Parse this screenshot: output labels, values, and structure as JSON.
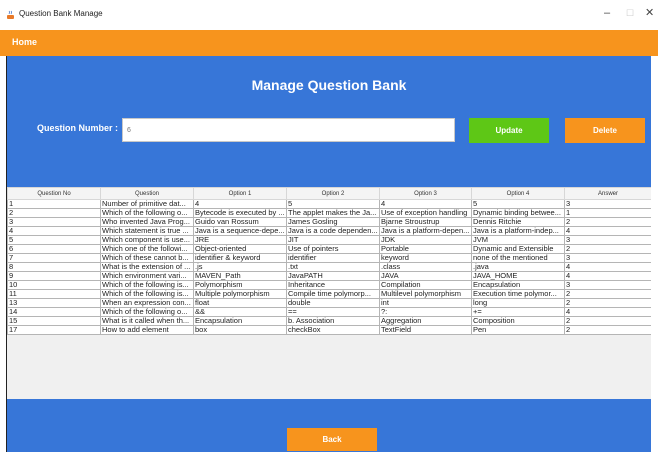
{
  "window": {
    "title": "Question Bank Manage",
    "minimize": "–",
    "maximize": "☐",
    "close": "✕"
  },
  "menu": {
    "home": "Home"
  },
  "header": {
    "title": "Manage Question Bank",
    "question_label": "Question Number :",
    "question_value": "6",
    "update_label": "Update",
    "delete_label": "Delete"
  },
  "colors": {
    "accent_orange": "#f7941d",
    "panel_blue": "#3776d8",
    "update_green": "#5ec716"
  },
  "table": {
    "columns": [
      "Question No",
      "Question",
      "Option 1",
      "Option 2",
      "Option 3",
      "Option 4",
      "Answer"
    ],
    "rows": [
      [
        "1",
        "Number of primitive dat...",
        "4",
        "5",
        "4",
        "5",
        "3"
      ],
      [
        "2",
        "Which of the following o...",
        "Bytecode is executed by ...",
        "The applet makes the Ja...",
        "Use of exception handling",
        "Dynamic binding betwee...",
        "1"
      ],
      [
        "3",
        "Who invented Java Prog...",
        "Guido van Rossum",
        "James Gosling",
        "Bjarne Stroustrup",
        "Dennis Ritchie",
        "2"
      ],
      [
        "4",
        "Which statement is true ...",
        "Java is a sequence-depe...",
        "Java is a code dependen...",
        "Java is a platform-depen...",
        "Java is a platform-indep...",
        "4"
      ],
      [
        "5",
        "Which component is use...",
        "JRE",
        "JIT",
        "JDK",
        "JVM",
        "3"
      ],
      [
        "6",
        "Which one of the followi...",
        "Object-oriented",
        "Use of pointers",
        "Portable",
        "Dynamic and Extensible",
        "2"
      ],
      [
        "7",
        "Which of these cannot b...",
        "identifier & keyword",
        "identifier",
        "keyword",
        "none of the mentioned",
        "3"
      ],
      [
        "8",
        "What is the extension of ...",
        ".js",
        ".txt",
        ".class",
        ".java",
        "4"
      ],
      [
        "9",
        "Which environment vari...",
        "MAVEN_Path",
        "JavaPATH",
        "JAVA",
        "JAVA_HOME",
        "4"
      ],
      [
        "10",
        "Which of the following is...",
        "Polymorphism",
        "Inheritance",
        "Compilation",
        "Encapsulation",
        "3"
      ],
      [
        "11",
        "Which of the following is...",
        "Multiple polymorphism",
        "Compile time polymorp...",
        "Multilevel polymorphism",
        "Execution time polymor...",
        "2"
      ],
      [
        "13",
        "When an expression con...",
        "float",
        "double",
        "int",
        "long",
        "2"
      ],
      [
        "14",
        "Which of the following o...",
        "&&",
        "==",
        "?:",
        "+=",
        "4"
      ],
      [
        "15",
        "What is it called when th...",
        "Encapsulation",
        "b. Association",
        "Aggregation",
        "Composition",
        "2"
      ],
      [
        "17",
        "How to add element",
        "box",
        "checkBox",
        "TextField",
        "Pen",
        "2"
      ]
    ]
  },
  "footer": {
    "back_label": "Back"
  }
}
